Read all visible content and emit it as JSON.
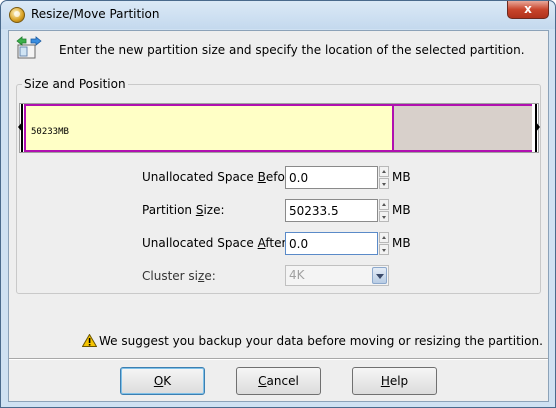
{
  "window": {
    "title": "Resize/Move Partition",
    "close_glyph": "x"
  },
  "header": {
    "icon": "resize-arrows-icon",
    "text": "Enter the new partition size and specify the location of the selected partition."
  },
  "group": {
    "label": "Size and Position"
  },
  "disk_bar": {
    "partition_label": "50233MB",
    "partition_fill_fraction": 0.727,
    "colors": {
      "partition": "#ffffc6",
      "border": "#b010b0",
      "free": "#d8d0cb"
    }
  },
  "fields": {
    "before": {
      "label_pre": "Unallocated Space ",
      "label_key": "B",
      "label_post": "efore:",
      "value": "0.0",
      "unit": "MB"
    },
    "size": {
      "label_pre": "Partition ",
      "label_key": "S",
      "label_post": "ize:",
      "value": "50233.5",
      "unit": "MB"
    },
    "after": {
      "label_pre": "Unallocated Space ",
      "label_key": "A",
      "label_post": "fter:",
      "value": "0.0",
      "unit": "MB"
    },
    "cluster": {
      "label_pre": "Cluster si",
      "label_key": "z",
      "label_post": "e:",
      "value": "4K"
    }
  },
  "warning": {
    "text": "We suggest you backup your data before moving or resizing the partition.",
    "icon": "warning-icon"
  },
  "buttons": {
    "ok": {
      "key": "O",
      "rest": "K"
    },
    "cancel": {
      "key": "C",
      "rest": "ancel"
    },
    "help": {
      "key": "H",
      "rest": "elp"
    }
  }
}
